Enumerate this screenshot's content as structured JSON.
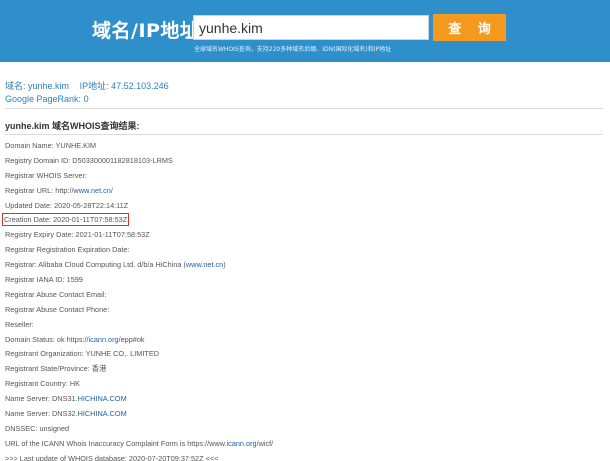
{
  "header": {
    "brand": "域名/IP地址:",
    "search_value": "yunhe.kim",
    "search_button": "查 询",
    "note": "全球域名WHOIS查询，支持220多种域名后缀、IDN(国际化域名)和IP地址"
  },
  "info": {
    "domain_label": "域名:",
    "domain_value": "yunhe.kim",
    "ip_label": "IP地址:",
    "ip_value": "47.52.103.246",
    "pagerank_label": "Google PageRank:",
    "pagerank_value": "0"
  },
  "result_title": "yunhe.kim 域名WHOIS查询结果:",
  "records": [
    {
      "text": "Domain Name: YUNHE.KIM"
    },
    {
      "text": "Registry Domain ID: D503300001182818103-LRMS"
    },
    {
      "text": "Registrar WHOIS Server:"
    },
    {
      "pre": "Registrar URL: http://",
      "link": "www.net.cn",
      "post": "/"
    },
    {
      "text": "Updated Date: 2020-05-28T22:14:11Z"
    },
    {
      "text": "Creation Date: 2020-01-11T07:58:53Z",
      "highlight": true
    },
    {
      "text": "Registry Expiry Date: 2021-01-11T07:58:53Z"
    },
    {
      "text": "Registrar Registration Expiration Date:"
    },
    {
      "pre": "Registrar: Alibaba Cloud Computing Ltd. d/b/a HiChina (",
      "link": "www.net.cn",
      "post": ")"
    },
    {
      "text": "Registrar IANA ID: 1599"
    },
    {
      "text": "Registrar Abuse Contact Email:"
    },
    {
      "text": "Registrar Abuse Contact Phone:"
    },
    {
      "text": "Reseller:"
    },
    {
      "pre": "Domain Status: ok https://",
      "link": "icann.org",
      "post": "/epp#ok"
    },
    {
      "text": "Registrant Organization: YUNHE CO,. LIMITED"
    },
    {
      "text": "Registrant State/Province: 香港"
    },
    {
      "text": "Registrant Country: HK"
    },
    {
      "pre": "Name Server: DNS31.",
      "link": "HICHINA.COM",
      "post": ""
    },
    {
      "pre": "Name Server: DNS32.",
      "link": "HICHINA.COM",
      "post": ""
    },
    {
      "text": "DNSSEC: unsigned"
    },
    {
      "pre": "URL of the ICANN Whois Inaccuracy Complaint Form is https://www.",
      "link": "icann.org",
      "post": "/wicf/"
    },
    {
      "text": ">>> Last update of WHOIS database: 2020-07-20T09:37:52Z <<<"
    }
  ]
}
